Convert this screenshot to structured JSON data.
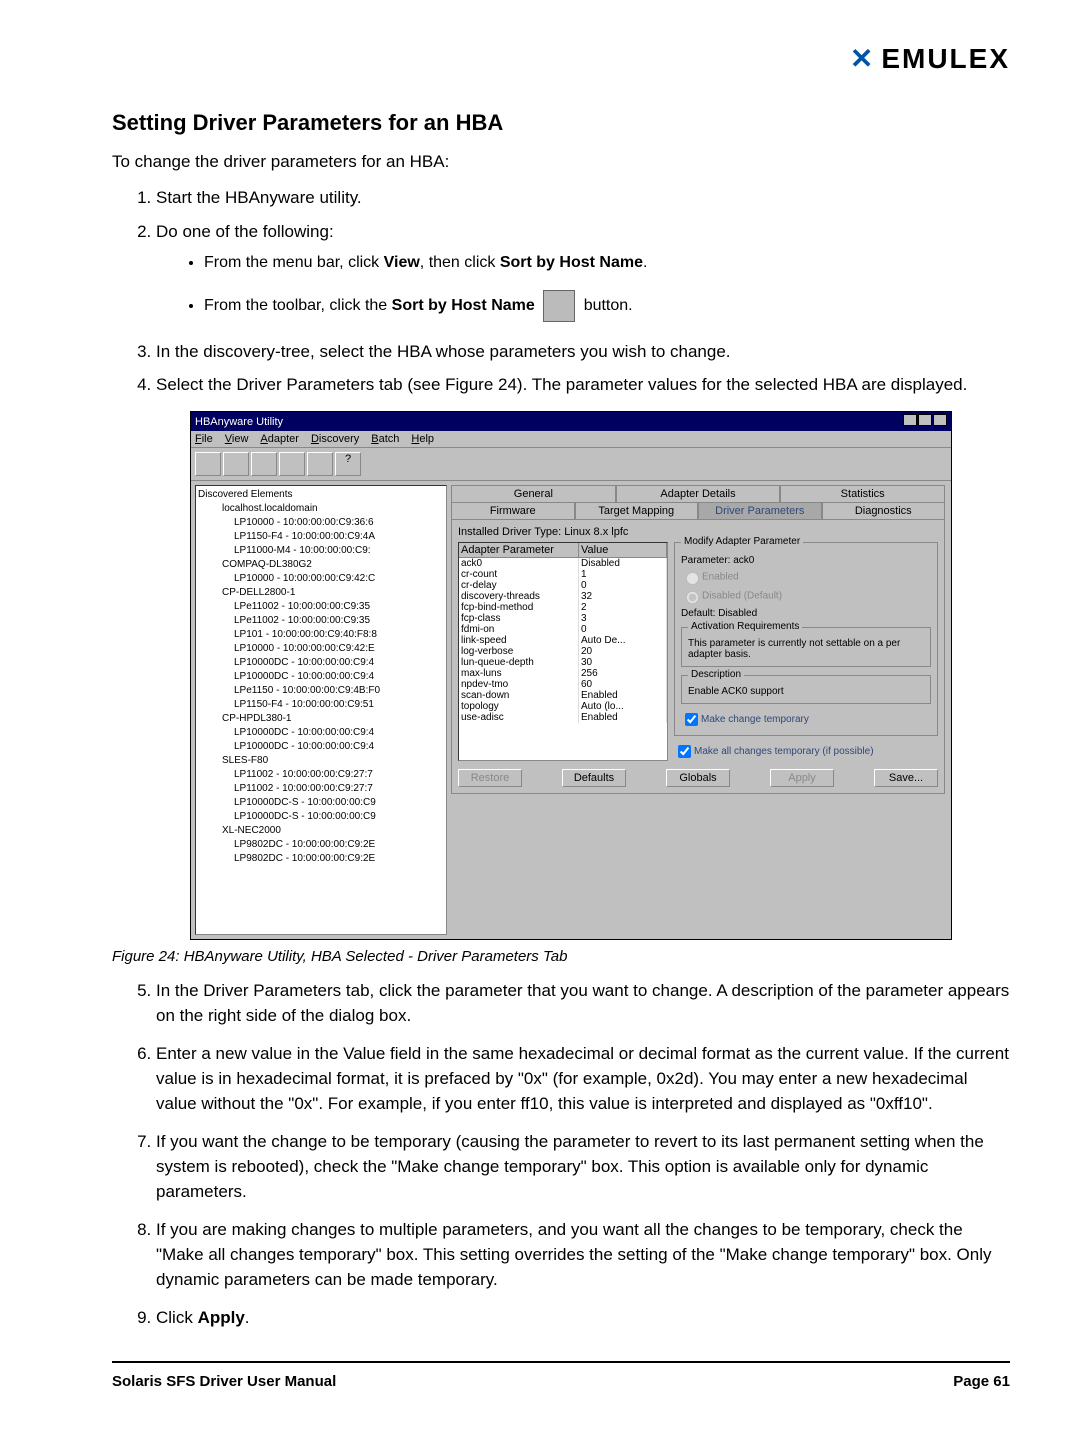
{
  "header": {
    "logo_text": "EMULEX"
  },
  "title": "Setting Driver Parameters for an HBA",
  "intro": "To change the driver parameters for an HBA:",
  "steps_a": [
    "Start the HBAnyware utility.",
    "Do one of the following:"
  ],
  "bullets": {
    "a_pre": "From the menu bar, click ",
    "a_b1": "View",
    "a_mid": ", then click ",
    "a_b2": "Sort by Host Name",
    "a_end": ".",
    "b_pre": "From the toolbar, click the ",
    "b_b1": "Sort by Host Name",
    "b_end": " button."
  },
  "steps_b": [
    "In the discovery-tree, select the HBA whose parameters you wish to change.",
    "Select the Driver Parameters tab (see Figure 24). The parameter values for the selected HBA are displayed."
  ],
  "screenshot": {
    "title": "HBAnyware Utility",
    "menus": [
      "File",
      "View",
      "Adapter",
      "Discovery",
      "Batch",
      "Help"
    ],
    "tree_root": "Discovered Elements",
    "tree": [
      {
        "l": 1,
        "t": "localhost.localdomain"
      },
      {
        "l": 2,
        "t": "LP10000 - 10:00:00:00:C9:36:6"
      },
      {
        "l": 2,
        "t": "LP1150-F4 - 10:00:00:00:C9:4A"
      },
      {
        "l": 2,
        "t": "LP11000-M4 - 10:00:00:00:C9:"
      },
      {
        "l": 1,
        "t": "COMPAQ-DL380G2"
      },
      {
        "l": 2,
        "t": "LP10000 - 10:00:00:00:C9:42:C"
      },
      {
        "l": 1,
        "t": "CP-DELL2800-1"
      },
      {
        "l": 2,
        "t": "LPe11002 - 10:00:00:00:C9:35"
      },
      {
        "l": 2,
        "t": "LPe11002 - 10:00:00:00:C9:35"
      },
      {
        "l": 2,
        "t": "LP101 - 10:00:00:00:C9:40:F8:8"
      },
      {
        "l": 2,
        "t": "LP10000 - 10:00:00:00:C9:42:E"
      },
      {
        "l": 2,
        "t": "LP10000DC - 10:00:00:00:C9:4"
      },
      {
        "l": 2,
        "t": "LP10000DC - 10:00:00:00:C9:4"
      },
      {
        "l": 2,
        "t": "LPe1150 - 10:00:00:00:C9:4B:F0"
      },
      {
        "l": 2,
        "t": "LP1150-F4 - 10:00:00:00:C9:51"
      },
      {
        "l": 1,
        "t": "CP-HPDL380-1"
      },
      {
        "l": 2,
        "t": "LP10000DC - 10:00:00:00:C9:4"
      },
      {
        "l": 2,
        "t": "LP10000DC - 10:00:00:00:C9:4"
      },
      {
        "l": 1,
        "t": "SLES-F80"
      },
      {
        "l": 2,
        "t": "LP11002 - 10:00:00:00:C9:27:7"
      },
      {
        "l": 2,
        "t": "LP11002 - 10:00:00:00:C9:27:7"
      },
      {
        "l": 2,
        "t": "LP10000DC-S - 10:00:00:00:C9"
      },
      {
        "l": 2,
        "t": "LP10000DC-S - 10:00:00:00:C9"
      },
      {
        "l": 1,
        "t": "XL-NEC2000"
      },
      {
        "l": 2,
        "t": "LP9802DC - 10:00:00:00:C9:2E"
      },
      {
        "l": 2,
        "t": "LP9802DC - 10:00:00:00:C9:2E"
      }
    ],
    "tabs_top": [
      "General",
      "Adapter Details",
      "Statistics"
    ],
    "tabs_bottom": [
      "Firmware",
      "Target Mapping",
      "Driver Parameters",
      "Diagnostics"
    ],
    "driver_type_label": "Installed Driver Type:",
    "driver_type_value": "Linux 8.x lpfc",
    "param_headers": [
      "Adapter Parameter",
      "Value"
    ],
    "params": [
      {
        "n": "ack0",
        "v": "Disabled"
      },
      {
        "n": "cr-count",
        "v": "1"
      },
      {
        "n": "cr-delay",
        "v": "0"
      },
      {
        "n": "discovery-threads",
        "v": "32"
      },
      {
        "n": "fcp-bind-method",
        "v": "2"
      },
      {
        "n": "fcp-class",
        "v": "3"
      },
      {
        "n": "fdmi-on",
        "v": "0"
      },
      {
        "n": "link-speed",
        "v": "Auto De..."
      },
      {
        "n": "log-verbose",
        "v": "20"
      },
      {
        "n": "lun-queue-depth",
        "v": "30"
      },
      {
        "n": "max-luns",
        "v": "256"
      },
      {
        "n": "npdev-tmo",
        "v": "60"
      },
      {
        "n": "scan-down",
        "v": "Enabled"
      },
      {
        "n": "topology",
        "v": "Auto (lo..."
      },
      {
        "n": "use-adisc",
        "v": "Enabled"
      }
    ],
    "modify_legend": "Modify Adapter Parameter",
    "modify_param": "Parameter: ack0",
    "radio_enabled": "Enabled",
    "radio_disabled": "Disabled  (Default)",
    "default_line": "Default: Disabled",
    "activation_legend": "Activation Requirements",
    "activation_text": "This parameter is currently not settable on a per adapter basis.",
    "desc_legend": "Description",
    "desc_text": "Enable ACK0 support",
    "chk_temp": "Make change temporary",
    "chk_all_temp": "Make all changes temporary (if possible)",
    "buttons": [
      "Restore",
      "Defaults",
      "Globals",
      "Apply",
      "Save..."
    ]
  },
  "caption": "Figure 24: HBAnyware Utility, HBA Selected - Driver Parameters Tab",
  "steps_c": [
    "In the Driver Parameters tab, click the parameter that you want to change. A description of the parameter appears on the right side of the dialog box.",
    "Enter a new value in the Value field in the same hexadecimal or decimal format as the current value. If the current value is in hexadecimal format, it is prefaced by \"0x\" (for example, 0x2d). You may enter a new hexadecimal value without the \"0x\". For example, if you enter ff10, this value is interpreted and displayed as \"0xff10\".",
    "If you want the change to be temporary (causing the parameter to revert to its last permanent setting when the system is rebooted), check the \"Make change temporary\" box. This option is available only for dynamic parameters.",
    "If you are making changes to multiple parameters, and you want all the changes to be temporary, check the \"Make all changes temporary\" box. This setting overrides the setting of the \"Make change temporary\" box. Only dynamic parameters can be made temporary."
  ],
  "step9_pre": "Click ",
  "step9_b": "Apply",
  "step9_end": ".",
  "footer": {
    "left": "Solaris SFS Driver User Manual",
    "right": "Page 61"
  }
}
